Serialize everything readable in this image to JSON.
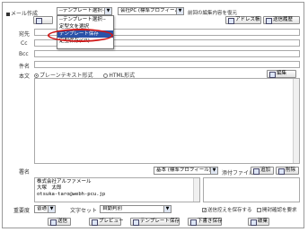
{
  "header": {
    "title": "メール作成",
    "template_select": "--テンプレート選択--",
    "account_select": "会社PC (標準プロフィール)",
    "edit_state_label": "前回の編集内容を復元",
    "addressbook_button": "アドレス帳",
    "send_history_button": "送信履歴"
  },
  "template_menu": {
    "items": [
      "--テンプレート選択--",
      "定型文を選択",
      "テンプレート保存",
      "定型保存(CR)"
    ],
    "highlighted_index": 2
  },
  "fields": {
    "to_label": "宛先",
    "cc_label": "Cc",
    "bcc_label": "Bcc",
    "subject_label": "件名",
    "body_label": "本文",
    "plain_text_option": "プレーンテキスト形式",
    "html_option": "HTML形式",
    "edit_button": "編集"
  },
  "signature": {
    "label": "署名",
    "select": "基本 (標準プロフィール)",
    "lines": [
      "株式会社アルファメール",
      "大塚　太郎",
      "otsuka-taro@webh-pcu.jp"
    ]
  },
  "attachments": {
    "label": "添付ファイル",
    "add_button": "追加",
    "remove_button": "削除"
  },
  "options": {
    "priority_label": "重要度",
    "priority_value": "普通",
    "charset_label": "文字セット",
    "charset_value": "自動判別",
    "save_sent_label": "送信控えを保存する",
    "receipt_label": "開封確認を要求"
  },
  "footer": {
    "send": "送信",
    "preview": "プレビュー",
    "save_template": "テンプレート保存",
    "save_draft": "下書き保存",
    "discard": "破棄"
  },
  "colors": {
    "highlight": "#2a52a8",
    "ring": "#d01818"
  }
}
